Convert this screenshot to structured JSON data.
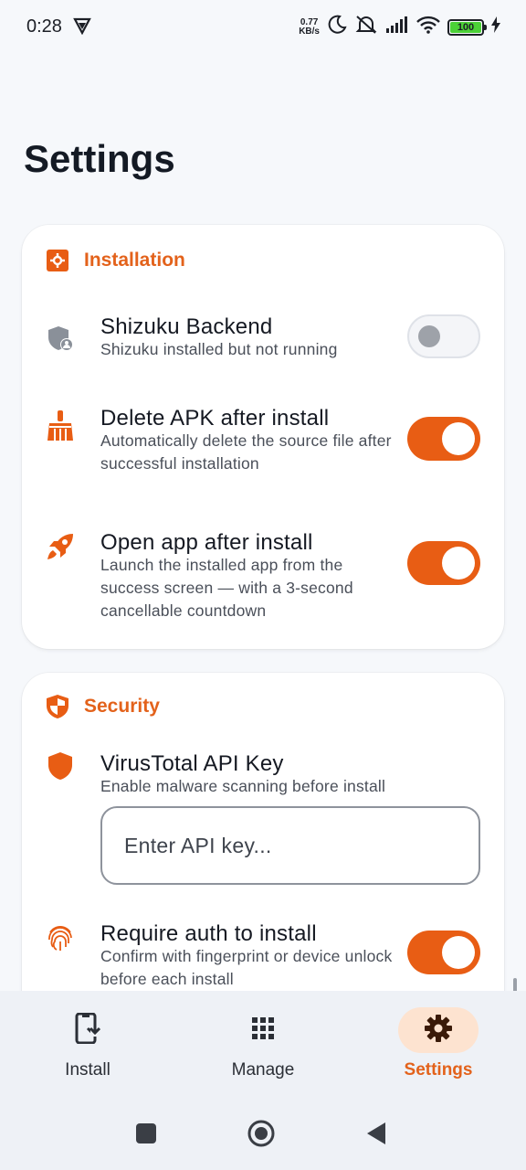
{
  "status_bar": {
    "time": "0:28",
    "net_speed_value": "0.77",
    "net_speed_unit": "KB/s",
    "battery": "100"
  },
  "page": {
    "title": "Settings"
  },
  "installation": {
    "title": "Installation",
    "items": [
      {
        "title": "Shizuku Backend",
        "subtitle": "Shizuku installed but not running",
        "enabled": false
      },
      {
        "title": "Delete APK after install",
        "subtitle": "Automatically delete the source file after successful installation",
        "enabled": true
      },
      {
        "title": "Open app after install",
        "subtitle": "Launch the installed app from the success screen — with a 3-second cancellable countdown",
        "enabled": true
      }
    ]
  },
  "security": {
    "title": "Security",
    "virustotal": {
      "title": "VirusTotal API Key",
      "subtitle": "Enable malware scanning before install",
      "input_value": "",
      "input_placeholder": "Enter API key..."
    },
    "auth": {
      "title": "Require auth to install",
      "subtitle": "Confirm with fingerprint or device unlock before each install",
      "enabled": true
    }
  },
  "bottom_nav": {
    "items": [
      {
        "label": "Install",
        "icon": "phone-download-icon",
        "active": false
      },
      {
        "label": "Manage",
        "icon": "grid-icon",
        "active": false
      },
      {
        "label": "Settings",
        "icon": "gear-icon",
        "active": true
      }
    ]
  },
  "colors": {
    "accent": "#e85d14",
    "accent_text": "#e3621b",
    "background": "#f6f8fb"
  }
}
